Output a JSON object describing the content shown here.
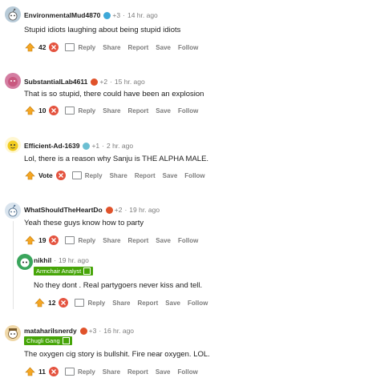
{
  "comments": [
    {
      "author": "EnvironmentalMud4870",
      "award_count": "+3",
      "time": "14 hr. ago",
      "body": "Stupid idiots laughing about being stupid idiots",
      "score": "42",
      "avatar_color": "#b8cbd8",
      "award_color": "#3ea8d8"
    },
    {
      "author": "SubstantialLab4611",
      "award_count": "+2",
      "time": "15 hr. ago",
      "body": "That is so stupid, there could have been an explosion",
      "score": "10",
      "avatar_color": "#d47ea2",
      "award_color": "#e0522a"
    },
    {
      "author": "Efficient-Ad-1639",
      "award_count": "+1",
      "time": "2 hr. ago",
      "body": "Lol, there is a reason why Sanju is THE ALPHA MALE.",
      "score": "Vote",
      "avatar_color": "#f2cc1e",
      "award_color": "#6cbfd2"
    },
    {
      "author": "WhatShouldTheHeartDo",
      "award_count": "+2",
      "time": "19 hr. ago",
      "body": "Yeah these guys know how to party",
      "score": "19",
      "avatar_color": "#d9e4ee",
      "award_color": "#e0522a"
    },
    {
      "author": "nikhil",
      "time": "19 hr. ago",
      "flair": "Armchair Analyst",
      "body": "No they dont . Real partygoers never kiss and tell.",
      "score": "12",
      "avatar_color": "#3aa55c"
    },
    {
      "author": "mataharilsnerdy",
      "award_count": "+3",
      "time": "16 hr. ago",
      "flair": "Chugli Gang",
      "body": "The oxygen cig story is bullshit. Fire near oxygen. LOL.",
      "score": "11",
      "avatar_color": "#f0d8a8",
      "award_color": "#e0522a"
    }
  ],
  "actions": {
    "reply": "Reply",
    "share": "Share",
    "report": "Report",
    "save": "Save",
    "follow": "Follow"
  },
  "colors": {
    "upvote": "#f5a623",
    "downvote": "#e4533f",
    "flair": "#46a508",
    "muted": "#7c7c7c"
  }
}
